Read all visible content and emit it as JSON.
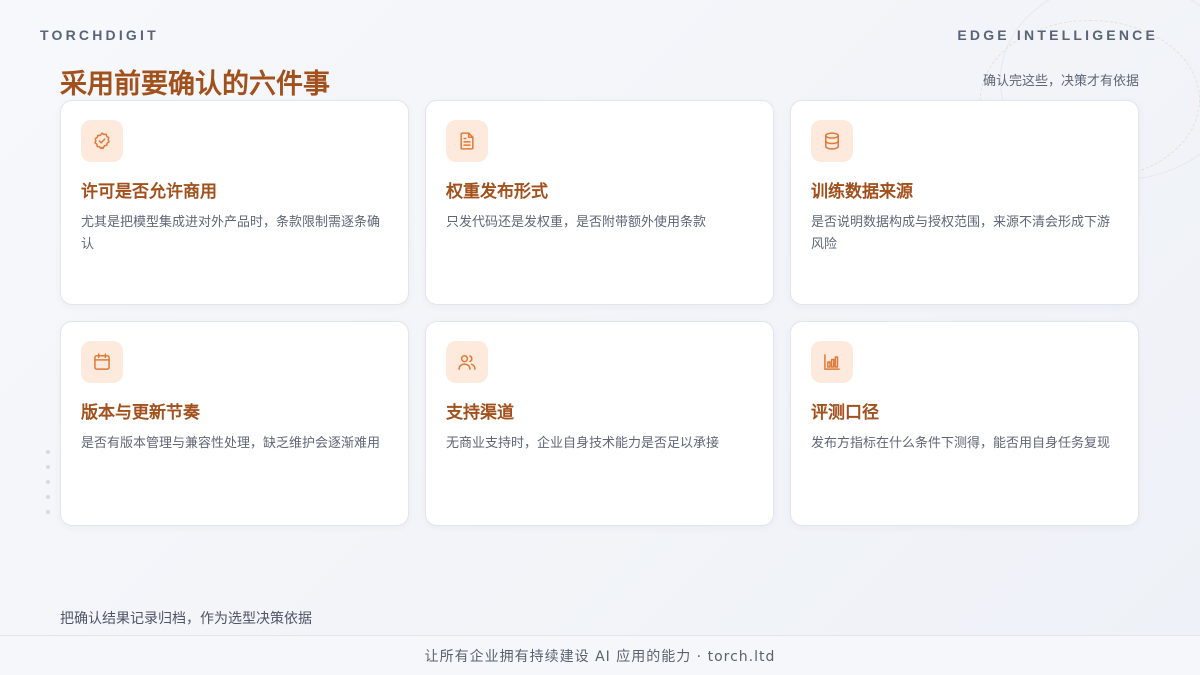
{
  "header": {
    "brand_left": "TORCHDIGIT",
    "brand_right": "EDGE INTELLIGENCE"
  },
  "main": {
    "title": "采用前要确认的六件事",
    "subtitle": "确认完这些，决策才有依据",
    "cards": [
      {
        "icon": "badge-check-icon",
        "title": "许可是否允许商用",
        "desc": "尤其是把模型集成进对外产品时，条款限制需逐条确认"
      },
      {
        "icon": "document-icon",
        "title": "权重发布形式",
        "desc": "只发代码还是发权重，是否附带额外使用条款"
      },
      {
        "icon": "database-icon",
        "title": "训练数据来源",
        "desc": "是否说明数据构成与授权范围，来源不清会形成下游风险"
      },
      {
        "icon": "calendar-icon",
        "title": "版本与更新节奏",
        "desc": "是否有版本管理与兼容性处理，缺乏维护会逐渐难用"
      },
      {
        "icon": "users-icon",
        "title": "支持渠道",
        "desc": "无商业支持时，企业自身技术能力是否足以承接"
      },
      {
        "icon": "bar-chart-icon",
        "title": "评测口径",
        "desc": "发布方指标在什么条件下测得，能否用自身任务复现"
      }
    ]
  },
  "footer": {
    "note": "把确认结果记录归档，作为选型决策依据",
    "tagline": "让所有企业拥有持续建设 AI 应用的能力 · torch.ltd"
  },
  "colors": {
    "accent": "#a2501c",
    "icon_bg": "#fdeadc",
    "icon_stroke": "#e07a3a"
  }
}
